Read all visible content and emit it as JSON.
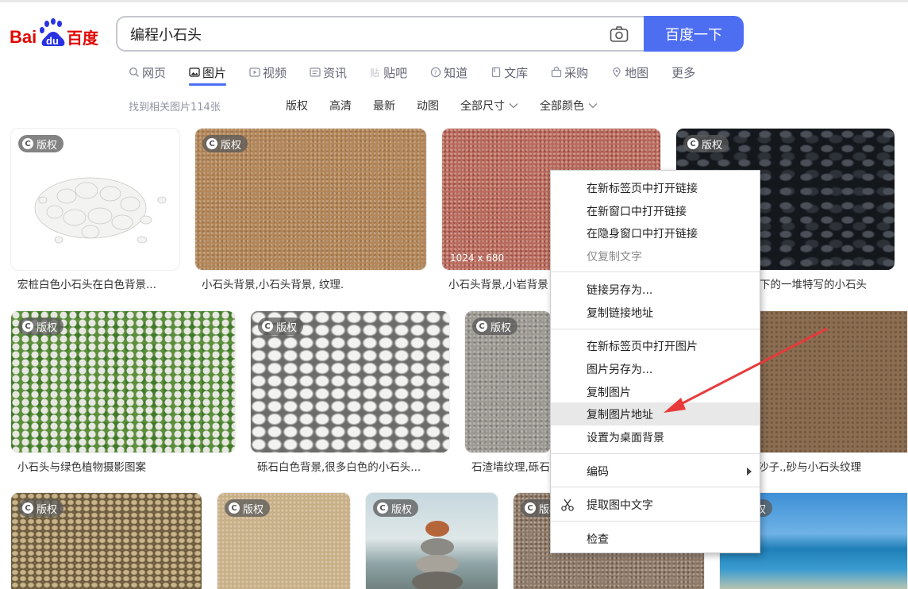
{
  "search": {
    "query": "编程小石头",
    "button_label": "百度一下"
  },
  "logo": {
    "text_left": "Bai",
    "text_mid": "du",
    "text_right": "百度"
  },
  "nav": [
    {
      "label": "网页",
      "icon": "search-icon"
    },
    {
      "label": "图片",
      "icon": "image-icon"
    },
    {
      "label": "视频",
      "icon": "video-icon"
    },
    {
      "label": "资讯",
      "icon": "news-icon"
    },
    {
      "label": "贴吧",
      "icon": "tieba-icon"
    },
    {
      "label": "知道",
      "icon": "question-icon"
    },
    {
      "label": "文库",
      "icon": "doc-icon"
    },
    {
      "label": "采购",
      "icon": "cart-icon"
    },
    {
      "label": "地图",
      "icon": "map-icon"
    },
    {
      "label": "更多",
      "icon": ""
    }
  ],
  "filters": {
    "result_count": "找到相关图片114张",
    "items": [
      "版权",
      "高清",
      "最新",
      "动图",
      "全部尺寸",
      "全部颜色"
    ]
  },
  "badge_label": "版权",
  "images": {
    "row1": [
      {
        "caption": "宏桩白色小石头在白色背景..."
      },
      {
        "caption": "小石头背景,小石头背景, 纹理."
      },
      {
        "caption": "小石头背景,小岩背景",
        "size": "1024 x 680"
      },
      {
        "caption": "下的一堆特写的小石头"
      }
    ],
    "row2": [
      {
        "caption": "小石头与绿色植物摄影图案"
      },
      {
        "caption": "砾石白色背景,很多白色的小石头..."
      },
      {
        "caption": "石渣墙纹理,砾石"
      },
      {
        "caption": "沙子.,砂与小石头纹理"
      }
    ]
  },
  "context_menu": {
    "items": [
      {
        "label": "在新标签页中打开链接"
      },
      {
        "label": "在新窗口中打开链接"
      },
      {
        "label": "在隐身窗口中打开链接"
      },
      {
        "label": "仅复制文字"
      },
      {
        "label": "链接另存为..."
      },
      {
        "label": "复制链接地址"
      },
      {
        "label": "在新标签页中打开图片"
      },
      {
        "label": "图片另存为..."
      },
      {
        "label": "复制图片"
      },
      {
        "label": "复制图片地址"
      },
      {
        "label": "设置为桌面背景"
      },
      {
        "label": "编码"
      },
      {
        "label": "提取图中文字"
      },
      {
        "label": "检查"
      }
    ]
  },
  "colors": {
    "accent": "#4e6ef2",
    "baidu_red": "#e10601",
    "baidu_blue": "#2932e1",
    "annotation_arrow": "#e83a3a"
  }
}
